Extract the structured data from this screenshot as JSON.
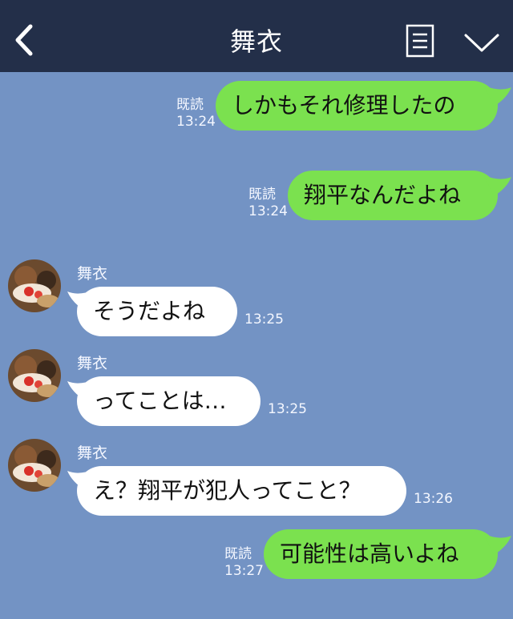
{
  "header": {
    "title": "舞衣"
  },
  "messages": [
    {
      "type": "out",
      "text": "しかもそれ修理したの",
      "read": "既読",
      "time": "13:24"
    },
    {
      "type": "out",
      "text": "翔平なんだよね",
      "read": "既読",
      "time": "13:24"
    },
    {
      "type": "in",
      "sender": "舞衣",
      "text": "そうだよね",
      "time": "13:25"
    },
    {
      "type": "in",
      "sender": "舞衣",
      "text": "ってことは…",
      "time": "13:25"
    },
    {
      "type": "in",
      "sender": "舞衣",
      "text": "え？翔平が犯人ってこと？",
      "time": "13:26"
    },
    {
      "type": "out",
      "text": "可能性は高いよね",
      "read": "既読",
      "time": "13:27"
    }
  ],
  "colors": {
    "background": "#7393c4",
    "header": "#232f49",
    "outgoing_bubble": "#7be14f",
    "incoming_bubble": "#ffffff"
  }
}
